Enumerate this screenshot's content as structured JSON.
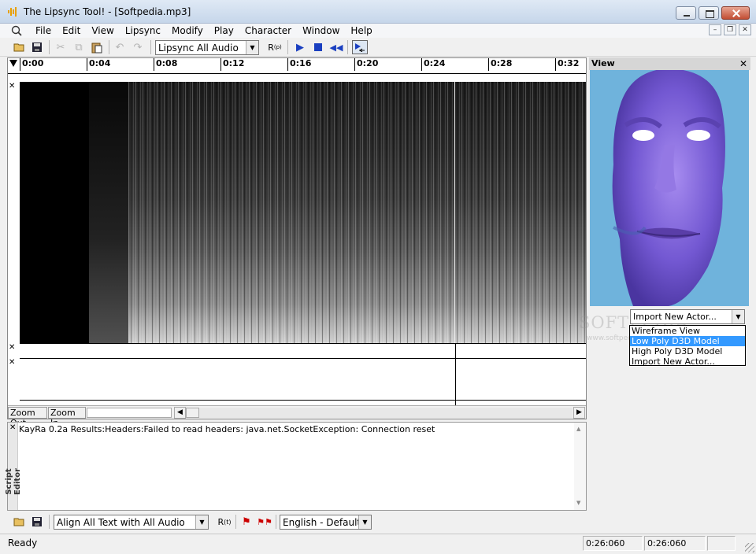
{
  "window": {
    "title": "The Lipsync Tool! - [Softpedia.mp3]"
  },
  "menubar": {
    "items": [
      "File",
      "Edit",
      "View",
      "Lipsync",
      "Modify",
      "Play",
      "Character",
      "Window",
      "Help"
    ]
  },
  "toolbar": {
    "audio_select": "Lipsync All Audio"
  },
  "timeline": {
    "ticks": [
      "0:00",
      "0:04",
      "0:08",
      "0:12",
      "0:16",
      "0:20",
      "0:24",
      "0:28",
      "0:32"
    ]
  },
  "zoom": {
    "out_label": "Zoom Out",
    "in_label": "Zoom In"
  },
  "view": {
    "title": "View",
    "actor_select": "Import New Actor...",
    "actor_options": [
      "Wireframe View",
      "Low Poly D3D Model",
      "High Poly D3D Model",
      "Import New Actor..."
    ],
    "selected_option_index": 1
  },
  "watermark": {
    "text": "SOFTPEDIA",
    "url": "www.softpedia.com"
  },
  "script_editor": {
    "label": "Script Editor",
    "output": "KayRa 0.2a Results:Headers:Failed to read headers: java.net.SocketException: Connection reset"
  },
  "bottom_toolbar": {
    "align_select": "Align All Text with All Audio",
    "language_select": "English - Default"
  },
  "status": {
    "text": "Ready",
    "time1": "0:26:060",
    "time2": "0:26:060"
  },
  "colors": {
    "view_bg": "#6fb3dc",
    "face": "#7b5ad6",
    "selection": "#3399ff"
  }
}
